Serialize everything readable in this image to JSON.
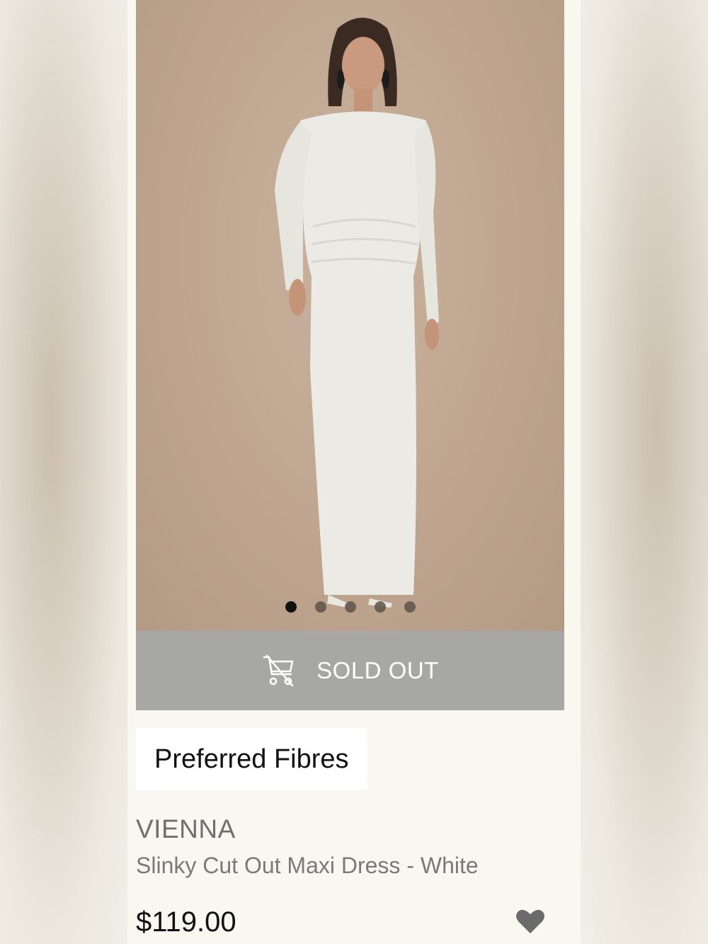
{
  "carousel": {
    "total_images": 5,
    "active_index": 0
  },
  "action_button": {
    "label": "SOLD OUT",
    "icon": "cart-disabled-icon"
  },
  "badge": {
    "label": "Preferred Fibres"
  },
  "product": {
    "brand": "VIENNA",
    "name": "Slinky Cut Out Maxi Dress - White",
    "price": "$119.00"
  },
  "wishlist": {
    "icon": "heart-icon"
  },
  "colors": {
    "sold_out_bg": "#a7a7a5",
    "card_bg": "#f8f7f0",
    "image_bg": "#bfa58f",
    "heart": "#6b6b6b"
  }
}
